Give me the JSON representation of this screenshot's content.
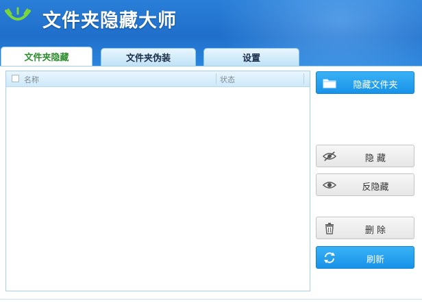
{
  "app": {
    "title": "文件夹隐藏大师",
    "logo_icon": "eye-logo-icon"
  },
  "tabs": [
    {
      "label": "文件夹隐藏",
      "active": true
    },
    {
      "label": "文件夹伪装",
      "active": false
    },
    {
      "label": "设置",
      "active": false
    }
  ],
  "list": {
    "columns": [
      "名称",
      "状态"
    ],
    "rows": []
  },
  "buttons": {
    "hide_folder": {
      "label": "隐藏文件夹",
      "icon": "folder-icon"
    },
    "hide": {
      "label": "隐 藏",
      "icon": "eye-hidden-icon"
    },
    "unhide": {
      "label": "反隐藏",
      "icon": "eye-icon"
    },
    "delete": {
      "label": "删 除",
      "icon": "trash-icon"
    },
    "refresh": {
      "label": "刷新",
      "icon": "refresh-icon"
    }
  },
  "colors": {
    "header": "#1f6fcb",
    "accent_blue": "#1893e8",
    "active_tab_text": "#2d8c2d"
  }
}
